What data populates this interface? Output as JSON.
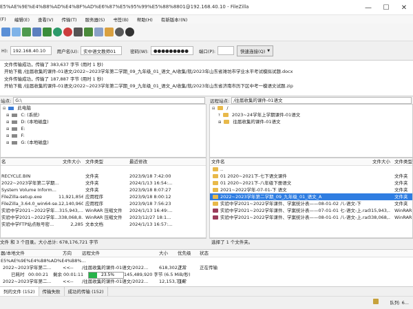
{
  "window": {
    "title": "E5%AE%9E%E4%B8%AD%E4%BF%AD%E6%87%E5%95%99%E5%88%8801@192.168.40.10 - FileZilla",
    "controls": [
      "—",
      "☐",
      "✕"
    ]
  },
  "menu": [
    "(F)",
    "编辑(E)",
    "查看(V)",
    "传输(T)",
    "服务器(S)",
    "书签(B)",
    "帮助(H)",
    "有新版本!(N)"
  ],
  "quickconnect": {
    "host_label": "H):",
    "host": "192.168.40.10",
    "user_label": "用户名(U):",
    "user": "实中语文教师01",
    "pass_label": "密码(W):",
    "pass": "●●●●●●●●●",
    "port_label": "端口(P):",
    "port": "",
    "button": "快速连接(Q)",
    "dropdown": "▼"
  },
  "log": [
    "文件传输成功，传输了 383,637 字节 (用时 1 秒)",
    "开始下载 /往届收集的课件-01语文/2022~2023学年第二学期_09_九年级_01_语文_A/收集/就/2023年山东省潍坊市学业水平考试模拟试题.docx",
    "文件传输成功，传输了 187,887 字节 (用时 1 秒)",
    "开始下载 /往届收集的课件-01语文/2022~2023学年第二学期_09_九年级_01_语文_A/收集/就/2023年山东省济南市历下区中考一模语文试题.zip"
  ],
  "local": {
    "site_label": "站点:",
    "site_path": "G:\\",
    "tree": [
      {
        "label": "此电脑",
        "type": "pc"
      },
      {
        "label": "C: (系统)",
        "type": "drive"
      },
      {
        "label": "D: (本地磁盘)",
        "type": "drive"
      },
      {
        "label": "E:",
        "type": "drive"
      },
      {
        "label": "F:",
        "type": "drive"
      },
      {
        "label": "G: (本地磁盘)",
        "type": "drive"
      }
    ],
    "columns": [
      "名",
      "文件大小",
      "文件类型",
      "最近修改"
    ],
    "files": [
      {
        "name": "",
        "size": "",
        "type": "",
        "modified": ""
      },
      {
        "name": "RECYCLE.BIN",
        "size": "",
        "type": "文件夹",
        "modified": "2023/9/18 7:42:00"
      },
      {
        "name": "2022~2023学年第二学期...",
        "size": "",
        "type": "文件夹",
        "modified": "2024/1/13 16:54:..."
      },
      {
        "name": "System Volume Inform...",
        "size": "",
        "type": "文件夹",
        "modified": "2023/9/18 8:07:27"
      },
      {
        "name": "FileZilla-setup.exe",
        "size": "11,921,856",
        "type": "应用程序",
        "modified": "2023/9/18 8:00:12"
      },
      {
        "name": "FileZilla_3.64.0_win64-se...",
        "size": "12,140,960",
        "type": "应用程序",
        "modified": "2023/9/18 7:56:23"
      },
      {
        "name": "实验中学2021~2022学年...",
        "size": "315,943,...",
        "type": "WinRAR 压缩文件",
        "modified": "2024/1/13 16:49:..."
      },
      {
        "name": "实验中学2021~2022学年...",
        "size": "338,068,8...",
        "type": "WinRAR 压缩文件",
        "modified": "2023/12/27 18:1..."
      },
      {
        "name": "实验中学FTP站点账号密...",
        "size": "2,285",
        "type": "文本文档",
        "modified": "2024/1/13 16:57:..."
      }
    ],
    "status": "文件 和 3 个目录。大小总计: 678,176,721 字节"
  },
  "remote": {
    "site_label": "远程站点:",
    "site_path": "/往届收集的课件-01语文",
    "tree": [
      {
        "label": "/",
        "type": "folder"
      },
      {
        "label": "2023~24学年上学期课件-01语文",
        "type": "folder"
      },
      {
        "label": "往届收集的课件-01语文",
        "type": "folder"
      }
    ],
    "columns": [
      "文件名",
      "文件大小",
      "文件类型"
    ],
    "files": [
      {
        "name": "..",
        "size": "",
        "type": "",
        "sel": false
      },
      {
        "name": "01 2020~2021下-七下语文课件",
        "size": "",
        "type": "文件夹",
        "sel": false
      },
      {
        "name": "01 2020~2021下-八年级下册语文",
        "size": "",
        "type": "文件夹",
        "sel": false
      },
      {
        "name": "2021~2022学年-07-01-下 语文",
        "size": "",
        "type": "文件夹",
        "sel": false
      },
      {
        "name": "2022~2023学年第二学期_09_九年级_01_语文_A",
        "size": "",
        "type": "文件夹",
        "sel": true
      },
      {
        "name": "实验中学2021~2022学年课件、学案统计表——08-01-02 八-语文-下",
        "size": "",
        "type": "文件夹",
        "sel": false
      },
      {
        "name": "实验中学2021~2022学年课件、学案统计表——07-01-01 七-语文-上.rar",
        "size": "315,943,...",
        "type": "WinRAR",
        "sel": false
      },
      {
        "name": "实验中学2021~2022学年课件、学案统计表——08-01-01 八-语文-上.rar",
        "size": "338,068,...",
        "type": "WinRAR",
        "sel": false
      }
    ],
    "status": "选择了 1 个文件夹。"
  },
  "queue": {
    "columns": [
      "器/本地文件",
      "方向",
      "远程文件",
      "大小",
      "优先级",
      "状态"
    ],
    "rows": [
      {
        "file": "E5%AE%9E%E4%B8%AD%E4%B8%...",
        "dir": "",
        "remote": "",
        "size": "",
        "prio": "",
        "state": ""
      },
      {
        "file": "2022~2023学年第二...",
        "dir": "<<--",
        "remote": "/往届收集的课件-01语文/2022...",
        "size": "618,302,7...",
        "prio": "正常",
        "state": "正在传输"
      }
    ],
    "progress": {
      "elapsed_label": "已耗时",
      "elapsed": "00:00:21",
      "remain_label": "剩余",
      "remain": "00:01:11",
      "percent": 0.235,
      "percent_text": "23.5%",
      "bytes": "145,489,920 字节 (6.5 MiB/秒)"
    },
    "row3": {
      "file": "2022~2023学年第二...",
      "dir": "<<--",
      "remote": "/往届收集的课件-01语文/2022...",
      "size": "12,153,716",
      "prio": "正常",
      "state": ""
    }
  },
  "tabs": [
    "列的文件 (152)",
    "传输失败",
    "成功的传输 (152)"
  ],
  "footer": {
    "queue": "队列: 6..."
  }
}
